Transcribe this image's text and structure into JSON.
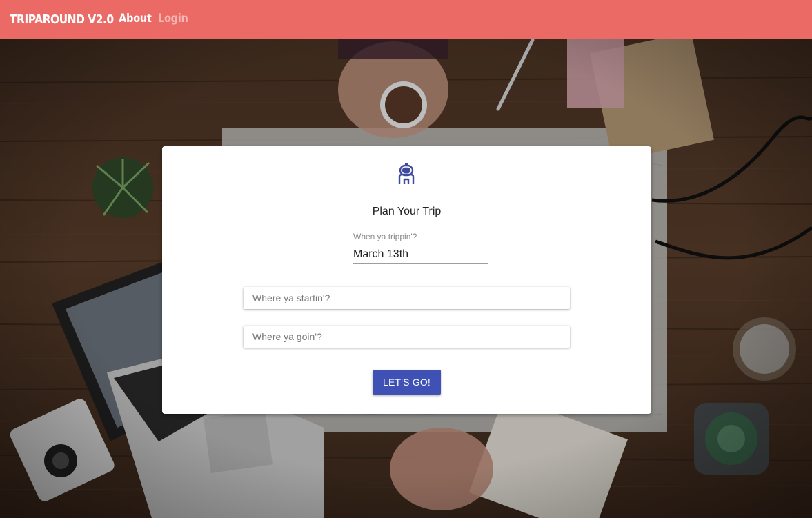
{
  "navbar": {
    "brand": "TRIPAROUND V2.0",
    "links": [
      {
        "label": "About"
      },
      {
        "label": "Login"
      }
    ]
  },
  "form": {
    "title": "Plan Your Trip",
    "date_label": "When ya trippin'?",
    "date_value": "March 13th",
    "start_placeholder": "Where ya startin'?",
    "destination_placeholder": "Where ya goin'?",
    "submit_label": "LET'S GO!"
  },
  "theme": {
    "navbar_color": "#ec6a66",
    "accent_color": "#3f51b5",
    "login_link_color": "#f6b6b3",
    "logo_color": "#3f4a9c"
  },
  "icons": {
    "logo": "astronaut-icon"
  }
}
